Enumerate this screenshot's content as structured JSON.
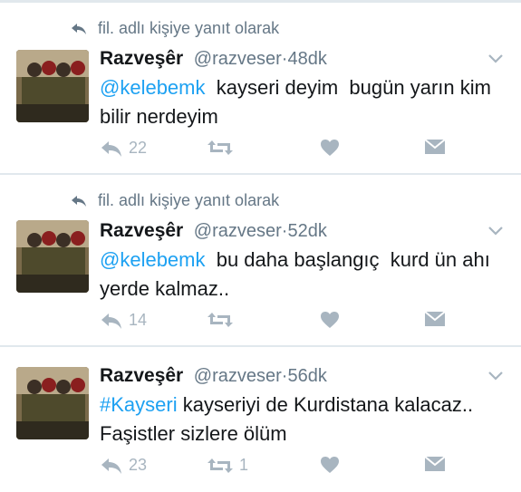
{
  "colors": {
    "accent": "#1da1f2",
    "muted": "#657786",
    "icon": "#a8b5c0",
    "separator": "#e1e8ed"
  },
  "tweets": [
    {
      "reply_context": "fil. adlı kişiye yanıt olarak",
      "display_name": "Razveşêr",
      "handle": "@razveser",
      "separator": "·",
      "time": "48dk",
      "lead": "@kelebemk",
      "body": "  kayseri deyim  bugün yarın kim bilir nerdeyim",
      "reply_count": "22",
      "retweet_count": "",
      "icons": [
        "reply-icon",
        "retweet-icon",
        "like-icon",
        "message-icon",
        "chevron-down-icon"
      ]
    },
    {
      "reply_context": "fil. adlı kişiye yanıt olarak",
      "display_name": "Razveşêr",
      "handle": "@razveser",
      "separator": "·",
      "time": "52dk",
      "lead": "@kelebemk",
      "body": "  bu daha başlangıç  kurd ün ahı yerde kalmaz..",
      "reply_count": "14",
      "retweet_count": "",
      "icons": [
        "reply-icon",
        "retweet-icon",
        "like-icon",
        "message-icon",
        "chevron-down-icon"
      ]
    },
    {
      "reply_context": "",
      "display_name": "Razveşêr",
      "handle": "@razveser",
      "separator": "·",
      "time": "56dk",
      "lead": "#Kayseri",
      "body": " kayseriyi de Kurdistana kalacaz.. Faşistler sizlere ölüm",
      "reply_count": "23",
      "retweet_count": "1",
      "icons": [
        "reply-icon",
        "retweet-icon",
        "like-icon",
        "message-icon",
        "chevron-down-icon"
      ]
    }
  ]
}
